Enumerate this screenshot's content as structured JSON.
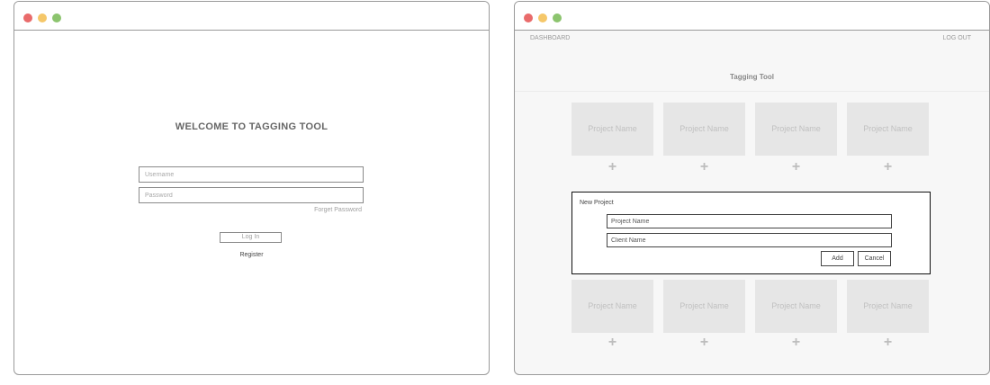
{
  "login": {
    "welcome": "WELCOME TO TAGGING TOOL",
    "username_placeholder": "Username",
    "password_placeholder": "Password",
    "forgot": "Forget Password",
    "login_button": "Log In",
    "register": "Register"
  },
  "dashboard": {
    "nav_dashboard": "DASHBOARD",
    "nav_logout": "LOG OUT",
    "title": "Tagging Tool",
    "card_label": "Project Name",
    "plus": "+"
  },
  "modal": {
    "title": "New Project",
    "project_placeholder": "Project Name",
    "client_placeholder": "Client Name",
    "add": "Add",
    "cancel": "Cancel"
  },
  "colors": {
    "close": "#e96b6b",
    "minimize": "#f5c769",
    "maximize": "#8cc46e",
    "card": "#e6e6e6"
  }
}
